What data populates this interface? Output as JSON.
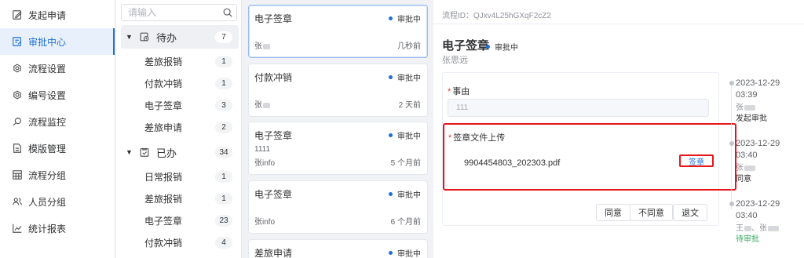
{
  "nav": {
    "items": [
      {
        "label": "发起申请",
        "icon": "edit-icon"
      },
      {
        "label": "审批中心",
        "icon": "approval-icon",
        "active": true
      },
      {
        "label": "流程设置",
        "icon": "settings-icon"
      },
      {
        "label": "编号设置",
        "icon": "settings-icon"
      },
      {
        "label": "流程监控",
        "icon": "monitor-search-icon"
      },
      {
        "label": "模版管理",
        "icon": "document-icon"
      },
      {
        "label": "流程分组",
        "icon": "grid-icon"
      },
      {
        "label": "人员分组",
        "icon": "users-icon"
      },
      {
        "label": "统计报表",
        "icon": "chart-line-icon"
      }
    ]
  },
  "categories": {
    "search_placeholder": "请输入",
    "groups": [
      {
        "label": "待办",
        "count": "7",
        "items": [
          {
            "label": "差旅报销",
            "count": "1"
          },
          {
            "label": "付款冲销",
            "count": "1"
          },
          {
            "label": "电子签章",
            "count": "3"
          },
          {
            "label": "差旅申请",
            "count": "2"
          }
        ]
      },
      {
        "label": "已办",
        "count": "34",
        "items": [
          {
            "label": "日常报销",
            "count": "1"
          },
          {
            "label": "差旅报销",
            "count": "1"
          },
          {
            "label": "电子签章",
            "count": "23"
          },
          {
            "label": "付款冲销",
            "count": "4"
          }
        ]
      }
    ]
  },
  "tasks": [
    {
      "title": "电子签章",
      "status": "审批中",
      "desc": "",
      "user": "张",
      "time": "几秒前"
    },
    {
      "title": "付款冲销",
      "status": "审批中",
      "desc": "",
      "user": "张",
      "time": "2 天前"
    },
    {
      "title": "电子签章",
      "status": "审批中",
      "desc": "1111",
      "user": "张info",
      "time": "5 个月前"
    },
    {
      "title": "电子签章",
      "status": "审批中",
      "desc": "",
      "user": "张info",
      "time": "6 个月前"
    },
    {
      "title": "差旅申请",
      "status": "审批中",
      "desc": "",
      "user": "",
      "time": ""
    }
  ],
  "detail": {
    "process_id_label": "流程ID：",
    "process_id": "QJxv4L25hGXqF2cZ2",
    "title": "电子签章",
    "status": "审批中",
    "applicant": "张思远",
    "reason_label": "事由",
    "reason_value": "111",
    "upload_label": "签章文件上传",
    "file_name": "9904454803_202303.pdf",
    "sign_label": "签章",
    "buttons": {
      "agree": "同意",
      "disagree": "不同意",
      "return": "退文"
    },
    "accent": "#1f6fd6",
    "highlight_color": "#e8141b"
  },
  "timeline": [
    {
      "date": "2023-12-29",
      "time": "03:39",
      "user": "张",
      "action": "发起审批"
    },
    {
      "date": "2023-12-29",
      "time": "03:40",
      "user": "张",
      "action": "同意"
    },
    {
      "date": "2023-12-29",
      "time": "03:40",
      "user": "王",
      "user2": "张",
      "action": "待审批"
    }
  ]
}
